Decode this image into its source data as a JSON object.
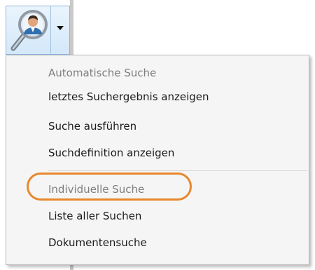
{
  "toolbar": {
    "search_button_icon": "magnifier-person-icon",
    "dropdown_icon": "chevron-down-icon"
  },
  "menu": {
    "group_auto": {
      "header": "Automatische Suche",
      "items": [
        "letztes Suchergebnis anzeigen",
        "Suche ausführen",
        "Suchdefinition anzeigen"
      ]
    },
    "group_individual": {
      "header": "Individuelle Suche",
      "items": [
        "Liste aller Suchen",
        "Dokumentensuche"
      ]
    },
    "highlight_color": "#e8882e"
  }
}
